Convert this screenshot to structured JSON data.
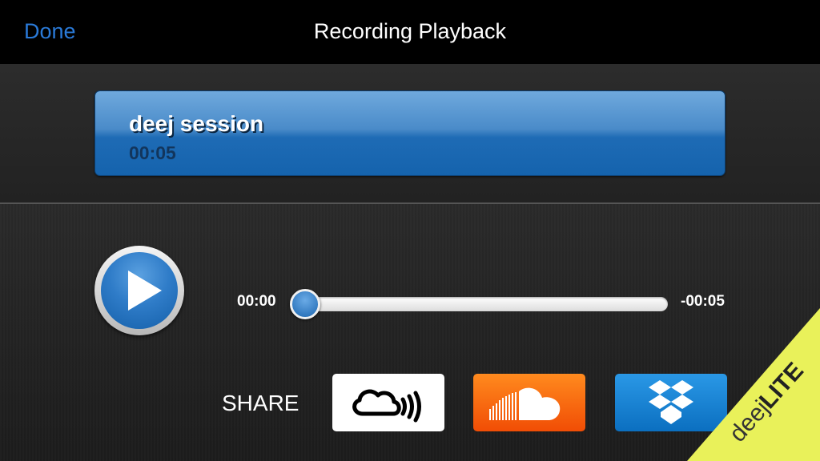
{
  "nav": {
    "done_label": "Done",
    "title": "Recording Playback"
  },
  "recording": {
    "name": "deej session",
    "duration": "00:05"
  },
  "player": {
    "elapsed": "00:00",
    "remaining": "-00:05",
    "progress_fraction": 0.0
  },
  "share": {
    "label": "SHARE",
    "services": [
      {
        "name": "Mixcloud",
        "icon": "mixcloud-icon"
      },
      {
        "name": "SoundCloud",
        "icon": "soundcloud-icon"
      },
      {
        "name": "Dropbox",
        "icon": "dropbox-icon"
      }
    ]
  },
  "badge": {
    "brand": "deej",
    "edition": "LITE"
  },
  "colors": {
    "accent_blue": "#2a7ad8",
    "soundcloud_orange": "#f26a0f",
    "dropbox_blue": "#1081d6",
    "lite_yellow": "#e9f15a"
  }
}
